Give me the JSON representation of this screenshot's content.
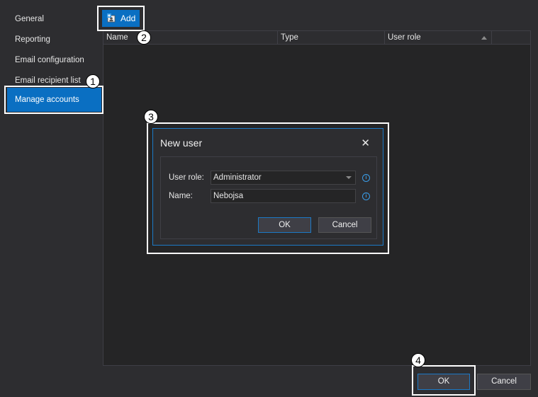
{
  "sidebar": {
    "items": [
      {
        "label": "General"
      },
      {
        "label": "Reporting"
      },
      {
        "label": "Email configuration"
      },
      {
        "label": "Email recipient list"
      },
      {
        "label": "Manage accounts",
        "selected": true
      }
    ]
  },
  "toolbar": {
    "add_label": "Add",
    "add_icon": "add-user-icon"
  },
  "grid": {
    "columns": [
      {
        "label": "Name"
      },
      {
        "label": "Type"
      },
      {
        "label": "User role",
        "sorted": "ascending"
      }
    ],
    "rows": []
  },
  "dialog": {
    "title": "New user",
    "close_glyph": "✕",
    "fields": {
      "user_role": {
        "label": "User role:",
        "value": "Administrator"
      },
      "name": {
        "label": "Name:",
        "value": "Nebojsa"
      }
    },
    "ok_label": "OK",
    "cancel_label": "Cancel"
  },
  "footer": {
    "ok_label": "OK",
    "cancel_label": "Cancel"
  },
  "callouts": [
    "1",
    "2",
    "3",
    "4"
  ],
  "colors": {
    "accent": "#0a6fc2",
    "background": "#2d2d30",
    "panel": "#252526",
    "callout": "#ffffff"
  }
}
